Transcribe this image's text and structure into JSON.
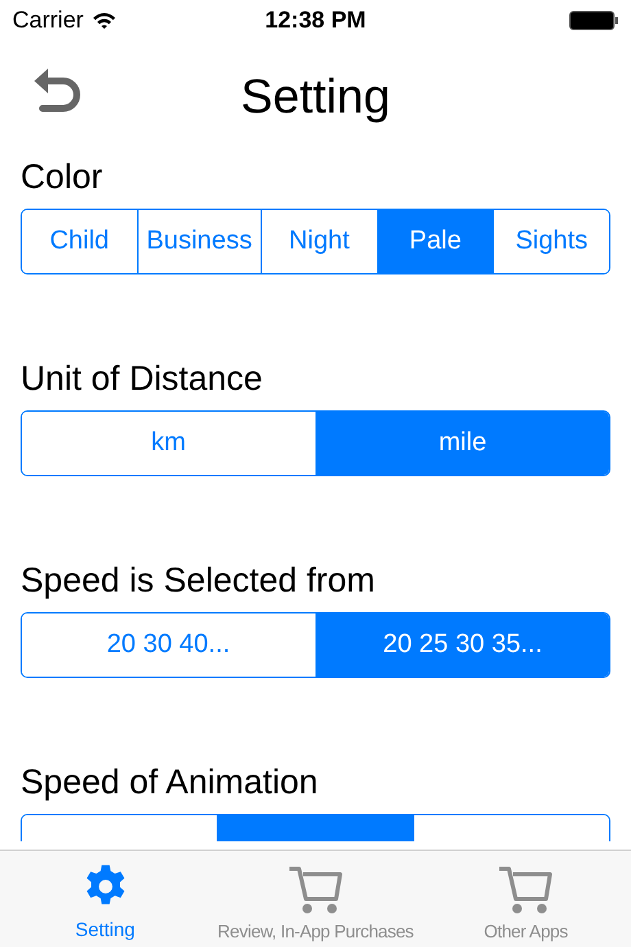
{
  "status_bar": {
    "carrier": "Carrier",
    "time": "12:38 PM"
  },
  "header": {
    "title": "Setting"
  },
  "sections": [
    {
      "label": "Color",
      "segments": [
        {
          "label": "Child",
          "selected": false
        },
        {
          "label": "Business",
          "selected": false
        },
        {
          "label": "Night",
          "selected": false
        },
        {
          "label": "Pale",
          "selected": true
        },
        {
          "label": "Sights",
          "selected": false
        }
      ]
    },
    {
      "label": "Unit of Distance",
      "segments": [
        {
          "label": "km",
          "selected": false
        },
        {
          "label": "mile",
          "selected": true
        }
      ]
    },
    {
      "label": "Speed is Selected from",
      "segments": [
        {
          "label": "20 30 40...",
          "selected": false
        },
        {
          "label": "20 25 30 35...",
          "selected": true
        }
      ]
    },
    {
      "label": "Speed of Animation",
      "segments": [
        {
          "selected": false
        },
        {
          "selected": true
        },
        {
          "selected": false
        }
      ]
    }
  ],
  "tab_bar": [
    {
      "label": "Setting",
      "kind": "gear",
      "selected": true
    },
    {
      "label": "Review, In-App Purchases",
      "kind": "cart",
      "selected": false
    },
    {
      "label": "Other Apps",
      "kind": "cart",
      "selected": false
    }
  ]
}
